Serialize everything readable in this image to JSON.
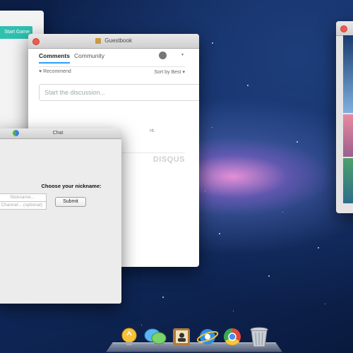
{
  "colors": {
    "accent": "#2e9fff",
    "start_game": "#2fc0b0",
    "close": "#ee5a50"
  },
  "back_window": {
    "start_button": "Start Game"
  },
  "guestbook": {
    "title": "Guestbook",
    "tabs": [
      "Comments",
      "Community"
    ],
    "recommend": "Recommend",
    "sort": "Sort by Best",
    "caret": "▾",
    "discussion_placeholder": "Start the discussion...",
    "partial_text": "nt.",
    "brand": "DISQUS"
  },
  "chat": {
    "title": "Chat",
    "prompt": "Choose your nickname:",
    "nickname_placeholder": "Nickname...",
    "channel_placeholder": "Channel... (optional)",
    "submit_label": "Submit"
  },
  "dock": {
    "items": [
      "lightbulb-icon",
      "messages-icon",
      "contacts-icon",
      "internet-explorer-icon",
      "chrome-icon",
      "trash-icon"
    ]
  }
}
